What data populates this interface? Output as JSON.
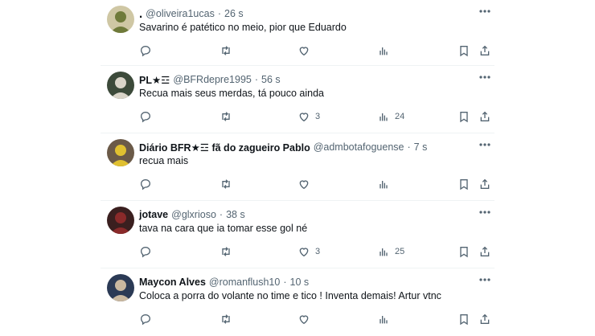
{
  "tweets": [
    {
      "name": "․",
      "handle": "@oliveira1ucas",
      "time": "26 s",
      "text": "Savarino é patético no meio, pior que Eduardo",
      "likes": "",
      "views": "",
      "avatar_colors": [
        "#cfc7a4",
        "#6f7a3a"
      ]
    },
    {
      "name": "PL★☲",
      "handle": "@BFRdepre1995",
      "time": "56 s",
      "text": "Recua mais seus merdas, tá pouco ainda",
      "likes": "3",
      "views": "24",
      "avatar_colors": [
        "#3c4a3a",
        "#d9d4c8"
      ]
    },
    {
      "name": "Diário BFR★☲ fã do zagueiro Pablo",
      "handle": "@admbotafoguense",
      "time": "7 s",
      "text": "recua mais",
      "likes": "",
      "views": "",
      "avatar_colors": [
        "#6b5a48",
        "#e0c030"
      ]
    },
    {
      "name": "jotave",
      "handle": "@glxrioso",
      "time": "38 s",
      "text": "tava na cara que ia tomar esse gol né",
      "likes": "3",
      "views": "25",
      "avatar_colors": [
        "#3a1f1f",
        "#8a2a2a"
      ]
    },
    {
      "name": "Maycon Alves",
      "handle": "@romanflush10",
      "time": "10 s",
      "text": "Coloca a porra do volante no time e tico ! Inventa demais! Artur vtnc",
      "likes": "",
      "views": "",
      "avatar_colors": [
        "#2b3a55",
        "#c9b8a0"
      ]
    }
  ],
  "separator": "·",
  "icons": [
    "reply-icon",
    "retweet-icon",
    "like-icon",
    "views-icon",
    "bookmark-icon",
    "share-icon",
    "more-icon"
  ],
  "colors": {
    "text": "#0f1419",
    "secondary": "#536471",
    "divider": "#eff3f4"
  }
}
